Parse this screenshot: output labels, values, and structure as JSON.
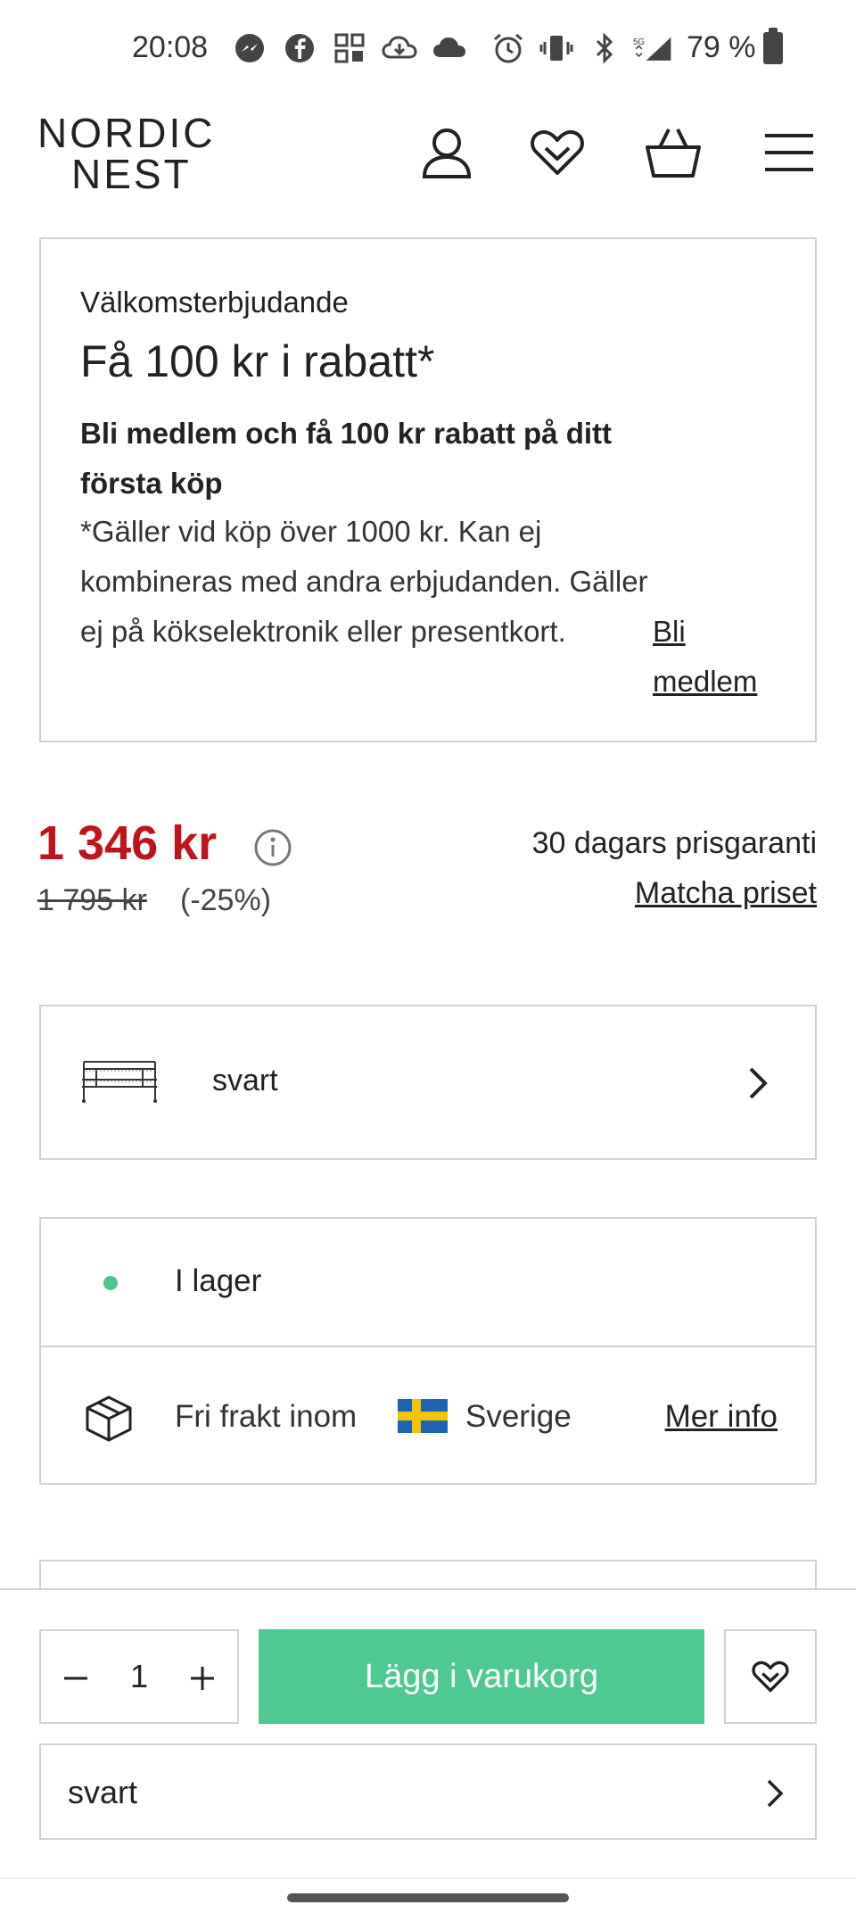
{
  "status_bar": {
    "time": "20:08",
    "battery": "79 %",
    "icons_left": [
      "messenger-icon",
      "facebook-icon",
      "widgets-icon",
      "cloud-download-icon",
      "cloud-icon"
    ],
    "icons_right": [
      "alarm-icon",
      "vibrate-icon",
      "bluetooth-icon",
      "signal-5g-icon"
    ]
  },
  "header": {
    "logo_line1": "NORDIC",
    "logo_line2": "NEST",
    "icons": [
      "account-icon",
      "wishlist-heart-icon",
      "basket-icon",
      "menu-icon"
    ]
  },
  "offer": {
    "kicker": "Välkomsterbjudande",
    "title": "Få 100 kr i rabatt*",
    "lead": "Bli medlem och få 100 kr rabatt på ditt första köp",
    "terms": "*Gäller vid köp över 1000 kr. Kan ej kombineras med andra erbjudanden. Gäller ej på kökselektronik eller presentkort.",
    "link": "Bli medlem"
  },
  "price": {
    "current": "1 346 kr",
    "original": "1 795 kr",
    "discount": "(-25%)",
    "guarantee": "30 dagars prisgaranti",
    "match_link": "Matcha priset"
  },
  "variant": {
    "label": "svart"
  },
  "availability": {
    "stock": "I lager",
    "shipping": "Fri frakt inom",
    "country": "Sverige",
    "info_link": "Mer info"
  },
  "sticky_bar": {
    "quantity": "1",
    "add_to_cart": "Lägg i varukorg",
    "variant_label": "svart"
  },
  "colors": {
    "accent_green": "#4fc992",
    "sale_red": "#c0141d",
    "border": "#d3d1cd"
  }
}
